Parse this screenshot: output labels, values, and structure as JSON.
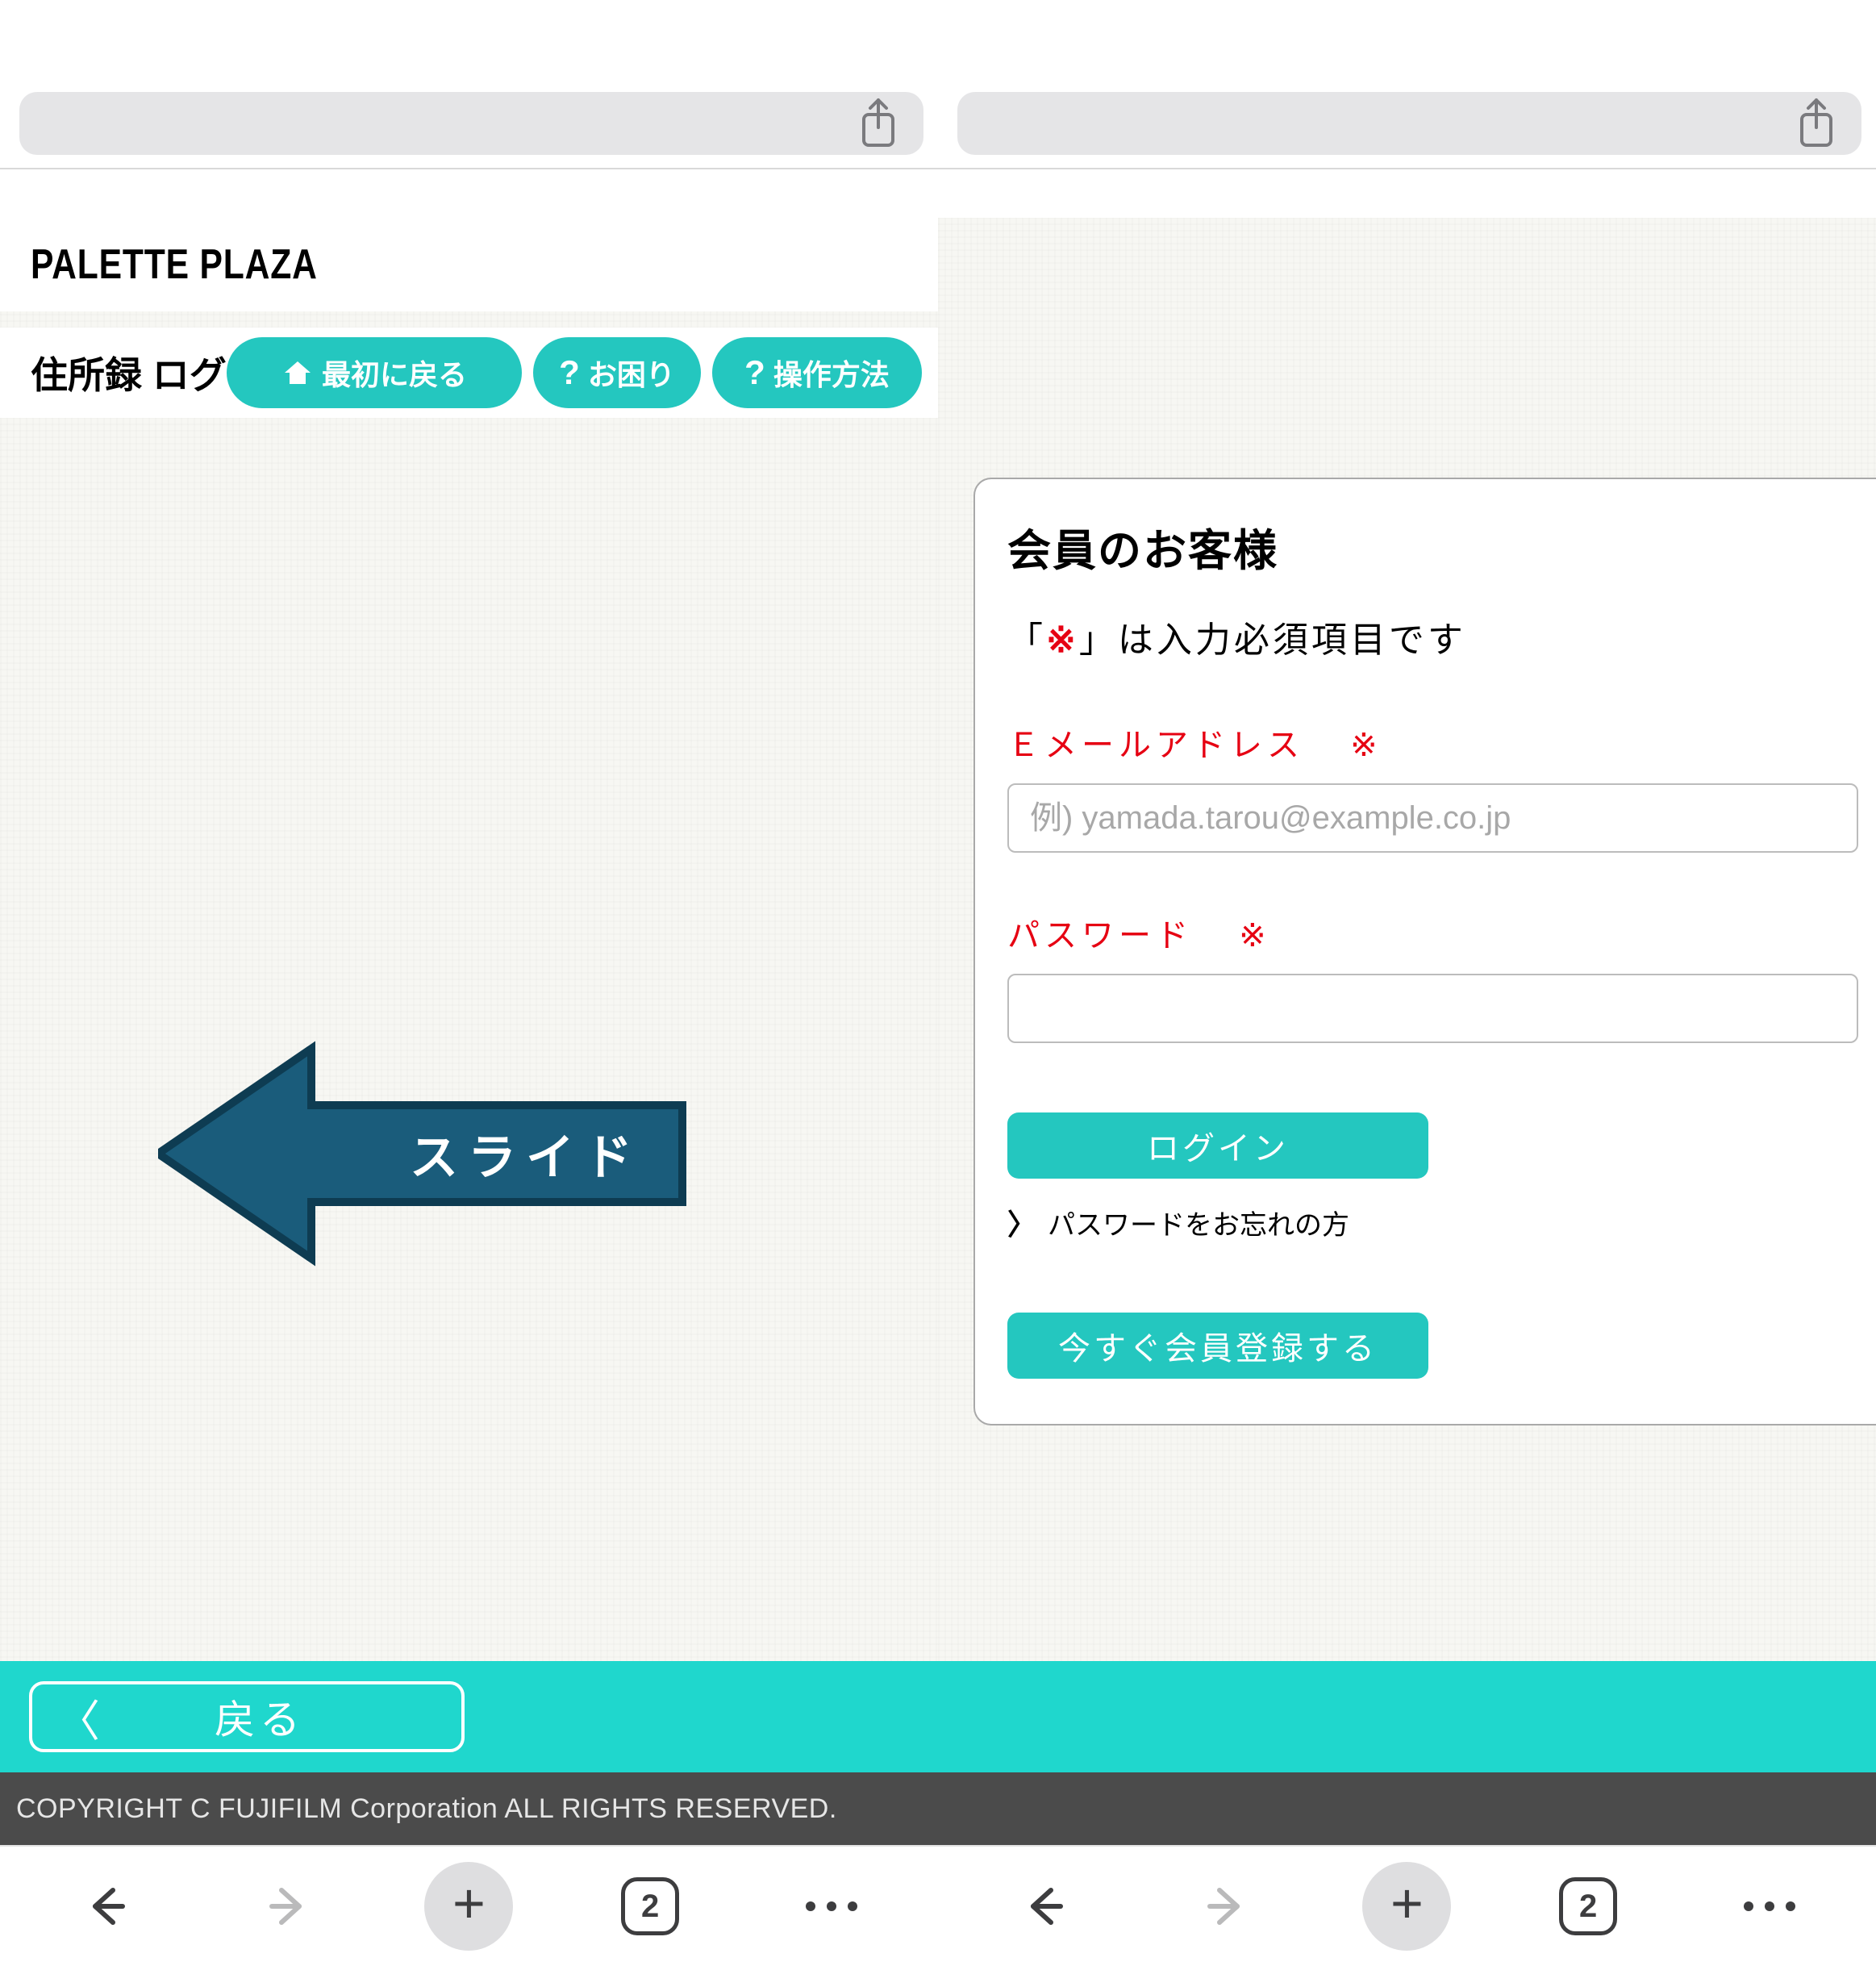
{
  "browser": {
    "tab_count": "2"
  },
  "left": {
    "brand": "PALETTE PLAZA",
    "page_title": "住所録 ログイン",
    "nav": {
      "home": "最初に戻る",
      "help": "お困り",
      "howto": "操作方法"
    },
    "arrow_label": "スライド",
    "back_label": "戻る",
    "copyright": "COPYRIGHT C FUJIFILM Corporation ALL RIGHTS RESERVED."
  },
  "right": {
    "card_title": "会員のお客様",
    "required_note_prefix": "「",
    "required_mark": "※",
    "required_note_suffix": "」は入力必須項目です",
    "email_label": "Ｅメールアドレス",
    "email_placeholder": "例) yamada.tarou@example.co.jp",
    "password_label": "パスワード",
    "login_button": "ログイン",
    "forgot_link": "パスワードをお忘れの方",
    "register_button": "今すぐ会員登録する"
  }
}
